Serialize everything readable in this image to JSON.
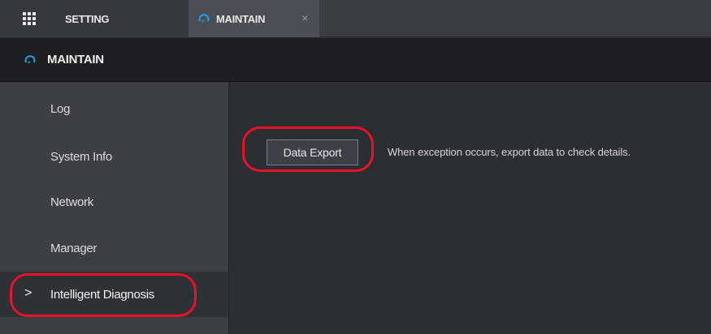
{
  "tabs": [
    {
      "label": "SETTING",
      "icon": "grid-icon"
    },
    {
      "label": "MAINTAIN",
      "icon": "gauge-icon",
      "close": "×"
    }
  ],
  "header": {
    "title": "MAINTAIN",
    "icon": "gauge-icon"
  },
  "sidebar": {
    "items": [
      {
        "label": "Log"
      },
      {
        "label": "System Info"
      },
      {
        "label": "Network"
      },
      {
        "label": "Manager"
      },
      {
        "label": "Intelligent Diagnosis",
        "active": true,
        "chevron": ">"
      }
    ]
  },
  "main": {
    "export_label": "Data Export",
    "export_description": "When exception occurs, export data to check details."
  },
  "colors": {
    "accent": "#1aa3e8",
    "annotation": "#e8122a"
  }
}
